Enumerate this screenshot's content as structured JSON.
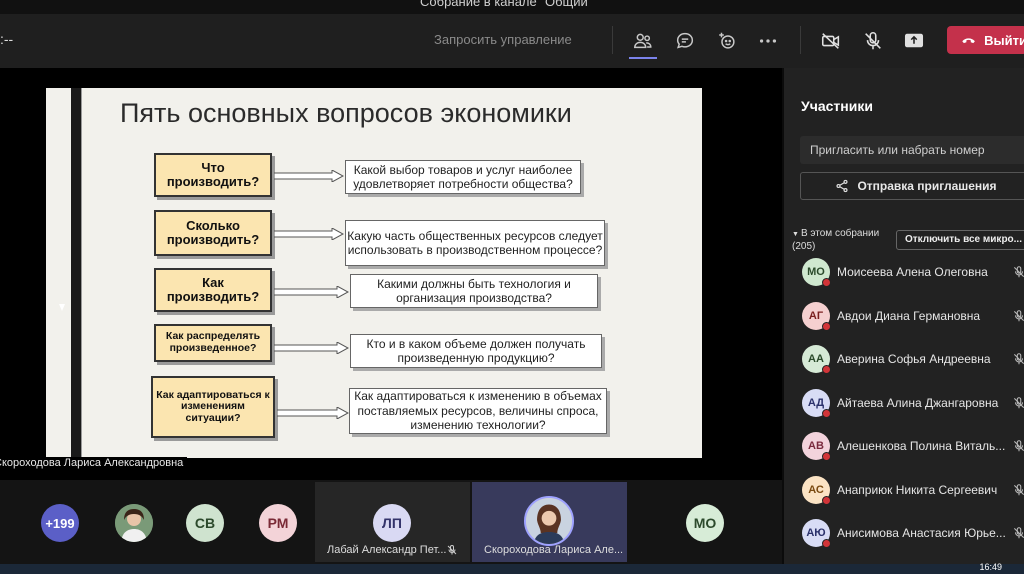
{
  "window": {
    "title": "Собрание в канале \"Общий\""
  },
  "toolbar": {
    "timer": ":--",
    "request_control": "Запросить управление",
    "leave_label": "Выйти",
    "icons": [
      "people-icon",
      "chat-icon",
      "reactions-icon",
      "more-icon",
      "camera-off-icon",
      "mic-off-icon",
      "share-screen-icon",
      "phone-icon"
    ]
  },
  "slide": {
    "title": "Пять основных вопросов экономики",
    "rows": [
      {
        "question": "Что производить?",
        "answer": "Какой выбор товаров и услуг наиболее удовлетворяет потребности общества?"
      },
      {
        "question": "Сколько производить?",
        "answer": "Какую часть общественных ресурсов следует использовать в производственном процессе?"
      },
      {
        "question": "Как производить?",
        "answer": "Какими должны быть технология и организация производства?"
      },
      {
        "question": "Как распределять произведенное?",
        "answer": "Кто и в каком объеме должен получать произведенную продукцию?"
      },
      {
        "question": "Как адаптироваться к изменениям ситуации?",
        "answer": "Как адаптироваться к изменению в объемах поставляемых ресурсов, величины спроса, изменению технологии?"
      }
    ]
  },
  "presenter": {
    "name": "Скороходова Лариса Александровна"
  },
  "tiles": [
    {
      "initials": "+199",
      "bg": "#5b5fc7",
      "fg": "#ffffff"
    },
    {
      "initials": "",
      "kind": "photo"
    },
    {
      "initials": "СВ",
      "bg": "#cfe3cf",
      "fg": "#2c4a2c"
    },
    {
      "initials": "РМ",
      "bg": "#f3d3d8",
      "fg": "#7a2a36"
    },
    {
      "initials": "ЛП",
      "bg": "#d9d9f3",
      "fg": "#33336b",
      "label": "Лабай Александр Пет..."
    },
    {
      "initials": "",
      "kind": "photo",
      "label": "Скороходова Лариса Але..."
    },
    {
      "initials": "МО",
      "bg": "#d7ecd7",
      "fg": "#2c4a2c"
    }
  ],
  "panel": {
    "title": "Участники",
    "invite_placeholder": "Пригласить или набрать номер",
    "share_invite": "Отправка приглашения",
    "section_label": "В этом собрании (205)",
    "mute_all": "Отключить все микро...",
    "people": [
      {
        "initials": "МО",
        "name": "Моисеева Алена Олеговна",
        "bg": "#cfe8cf",
        "fg": "#2a4a2a"
      },
      {
        "initials": "АГ",
        "name": "Авдои Диана Германовна",
        "bg": "#f5d0d0",
        "fg": "#7a2020"
      },
      {
        "initials": "АА",
        "name": "Аверина Софья Андреевна",
        "bg": "#d6ead6",
        "fg": "#2a4a2a"
      },
      {
        "initials": "АД",
        "name": "Айтаева Алина Джангаровна",
        "bg": "#d8dcf5",
        "fg": "#2a306a"
      },
      {
        "initials": "АВ",
        "name": "Алешенкова Полина Виталь...",
        "bg": "#f3d3dc",
        "fg": "#7a2a3e"
      },
      {
        "initials": "АС",
        "name": "Анаприюк Никита Сергеевич",
        "bg": "#fbe3c4",
        "fg": "#7a4a10"
      },
      {
        "initials": "АЮ",
        "name": "Анисимова Анастасия Юрье...",
        "bg": "#d8dcf5",
        "fg": "#2a306a"
      }
    ]
  },
  "taskbar": {
    "clock": "16:49"
  }
}
